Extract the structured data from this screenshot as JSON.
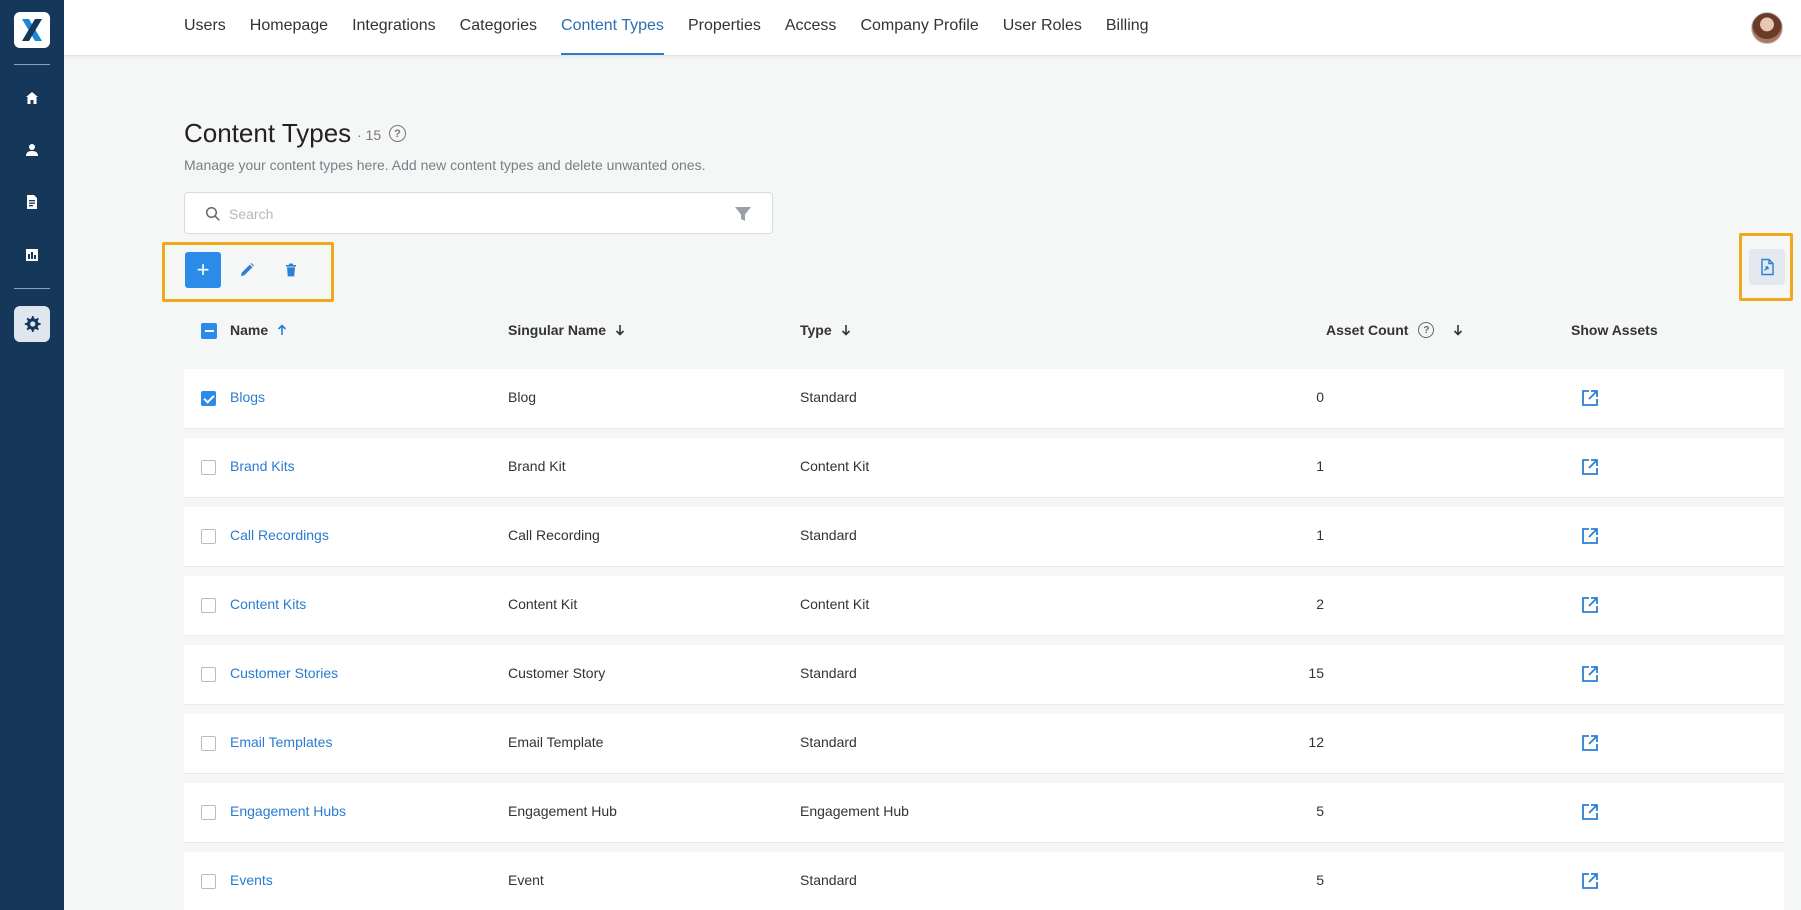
{
  "sidebar": {
    "logo": "X",
    "items": [
      {
        "name": "home-icon"
      },
      {
        "name": "user-icon"
      },
      {
        "name": "document-icon"
      },
      {
        "name": "analytics-icon"
      },
      {
        "name": "settings-icon",
        "active": true
      }
    ]
  },
  "nav": {
    "tabs": [
      {
        "label": "Users"
      },
      {
        "label": "Homepage"
      },
      {
        "label": "Integrations"
      },
      {
        "label": "Categories"
      },
      {
        "label": "Content Types",
        "active": true
      },
      {
        "label": "Properties"
      },
      {
        "label": "Access"
      },
      {
        "label": "Company Profile"
      },
      {
        "label": "User Roles"
      },
      {
        "label": "Billing"
      }
    ]
  },
  "header": {
    "title": "Content Types",
    "count": "· 15",
    "help": "?",
    "subtitle": "Manage your content types here. Add new content types and delete unwanted ones."
  },
  "search": {
    "placeholder": "Search",
    "value": ""
  },
  "toolbar": {
    "add_label": "+"
  },
  "table": {
    "columns": [
      {
        "label": "Name",
        "sort": "asc"
      },
      {
        "label": "Singular Name",
        "sort": "desc"
      },
      {
        "label": "Type",
        "sort": "desc"
      },
      {
        "label": "Asset Count",
        "sort": "desc",
        "help": "?"
      },
      {
        "label": "Show Assets"
      }
    ],
    "rows": [
      {
        "name": "Blogs",
        "singular": "Blog",
        "type": "Standard",
        "count": "0",
        "checked": true
      },
      {
        "name": "Brand Kits",
        "singular": "Brand Kit",
        "type": "Content Kit",
        "count": "1",
        "checked": false
      },
      {
        "name": "Call Recordings",
        "singular": "Call Recording",
        "type": "Standard",
        "count": "1",
        "checked": false
      },
      {
        "name": "Content Kits",
        "singular": "Content Kit",
        "type": "Content Kit",
        "count": "2",
        "checked": false
      },
      {
        "name": "Customer Stories",
        "singular": "Customer Story",
        "type": "Standard",
        "count": "15",
        "checked": false
      },
      {
        "name": "Email Templates",
        "singular": "Email Template",
        "type": "Standard",
        "count": "12",
        "checked": false
      },
      {
        "name": "Engagement Hubs",
        "singular": "Engagement Hub",
        "type": "Engagement Hub",
        "count": "5",
        "checked": false
      },
      {
        "name": "Events",
        "singular": "Event",
        "type": "Standard",
        "count": "5",
        "checked": false
      }
    ]
  },
  "colors": {
    "sidebar": "#15375a",
    "accent": "#2b8be8",
    "link": "#2a7cd0",
    "highlight": "#f0a81c"
  }
}
